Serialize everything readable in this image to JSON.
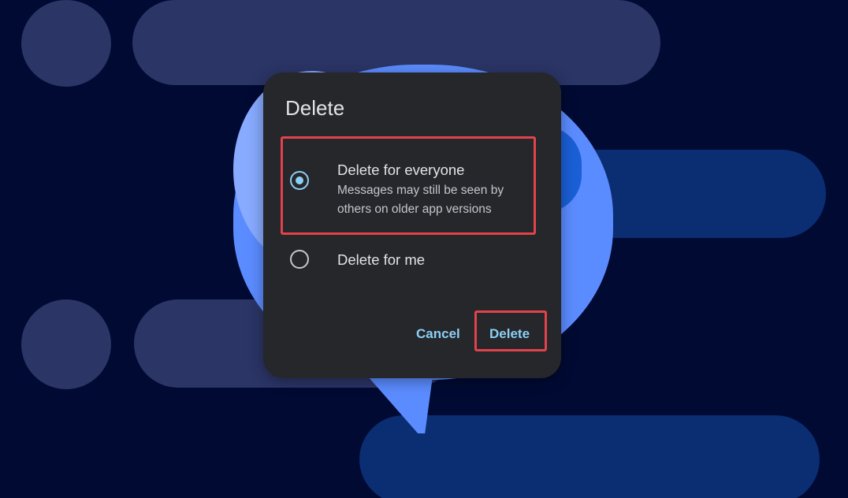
{
  "dialog": {
    "title": "Delete",
    "options": [
      {
        "label": "Delete for everyone",
        "description": "Messages may still be seen by others on older app versions",
        "selected": true
      },
      {
        "label": "Delete for me",
        "selected": false
      }
    ],
    "cancel_label": "Cancel",
    "confirm_label": "Delete"
  },
  "colors": {
    "background": "#010a33",
    "dialog_surface": "#25272b",
    "accent": "#8ccff5",
    "highlight": "#e2434b",
    "bubble": "#5b8cff"
  }
}
